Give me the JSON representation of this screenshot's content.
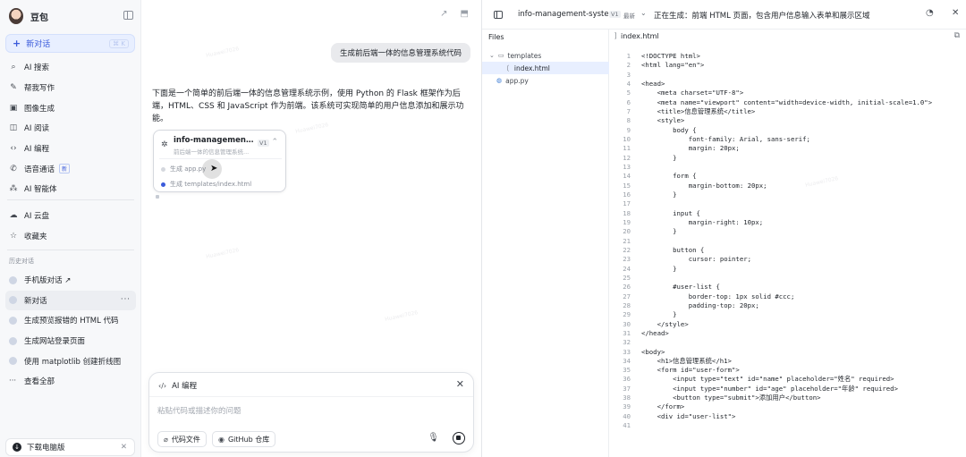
{
  "app": {
    "name": "豆包"
  },
  "sidebar": {
    "new_chat": {
      "label": "新对话",
      "shortcut": "⌘ K"
    },
    "nav": [
      {
        "icon": "ai-search-icon",
        "label": "AI 搜索"
      },
      {
        "icon": "writing-icon",
        "label": "帮我写作"
      },
      {
        "icon": "image-gen-icon",
        "label": "图像生成"
      },
      {
        "icon": "reading-icon",
        "label": "AI 阅读"
      },
      {
        "icon": "code-icon",
        "label": "AI 编程"
      },
      {
        "icon": "phone-icon",
        "label": "语音通话",
        "tag": "新"
      },
      {
        "icon": "agent-icon",
        "label": "AI 智能体"
      }
    ],
    "nav2": [
      {
        "icon": "cloud-icon",
        "label": "AI 云盘"
      },
      {
        "icon": "favorites-icon",
        "label": "收藏夹"
      }
    ],
    "history_title": "历史对话",
    "history": [
      {
        "label": "手机版对话 ↗"
      },
      {
        "label": "新对话",
        "active": true,
        "more": "···"
      },
      {
        "label": "生成预览报错的 HTML 代码"
      },
      {
        "label": "生成网站登录页面"
      },
      {
        "label": "使用 matplotlib 创建折线图"
      },
      {
        "label": "查看全部",
        "icon": "ellipsis-icon"
      }
    ],
    "download": {
      "label": "下载电脑版"
    }
  },
  "chat": {
    "user_message": "生成前后端一体的信息管理系统代码",
    "ai_message": "下面是一个简单的前后端一体的信息管理系统示例，使用 Python 的 Flask 框架作为后端，HTML、CSS 和 JavaScript 作为前端。该系统可实现简单的用户信息添加和展示功能。",
    "card": {
      "title": "info-management-sy...",
      "subtitle": "前后端一体的信息管理系统...",
      "version": "V1",
      "steps": [
        {
          "label": "生成 app.py",
          "state": "done"
        },
        {
          "label": "生成 templates/index.html",
          "state": "active"
        }
      ]
    },
    "composer": {
      "mode": "AI 编程",
      "placeholder": "粘贴代码或描述你的问题",
      "chip_code": "代码文件",
      "chip_github": "GitHub 仓库"
    }
  },
  "code_panel": {
    "project": "info-management-system",
    "version": "V1",
    "latest": "最新",
    "status": "正在生成：前端 HTML 页面，包含用户信息输入表单和展示区域",
    "files_title": "Files",
    "tree": [
      {
        "label": "templates",
        "kind": "folder",
        "indent": 1
      },
      {
        "label": "index.html",
        "kind": "file",
        "indent": 2,
        "selected": true
      },
      {
        "label": "app.py",
        "kind": "py",
        "indent": 1
      }
    ],
    "open_file": "index.html",
    "code_lines": [
      "<!DOCTYPE html>",
      "<html lang=\"en\">",
      "",
      "<head>",
      "    <meta charset=\"UTF-8\">",
      "    <meta name=\"viewport\" content=\"width=device-width, initial-scale=1.0\">",
      "    <title>信息管理系统</title>",
      "    <style>",
      "        body {",
      "            font-family: Arial, sans-serif;",
      "            margin: 20px;",
      "        }",
      "",
      "        form {",
      "            margin-bottom: 20px;",
      "        }",
      "",
      "        input {",
      "            margin-right: 10px;",
      "        }",
      "",
      "        button {",
      "            cursor: pointer;",
      "        }",
      "",
      "        #user-list {",
      "            border-top: 1px solid #ccc;",
      "            padding-top: 20px;",
      "        }",
      "    </style>",
      "</head>",
      "",
      "<body>",
      "    <h1>信息管理系统</h1>",
      "    <form id=\"user-form\">",
      "        <input type=\"text\" id=\"name\" placeholder=\"姓名\" required>",
      "        <input type=\"number\" id=\"age\" placeholder=\"年龄\" required>",
      "        <button type=\"submit\">添加用户</button>",
      "    </form>",
      "    <div id=\"user-list\">",
      ""
    ]
  }
}
